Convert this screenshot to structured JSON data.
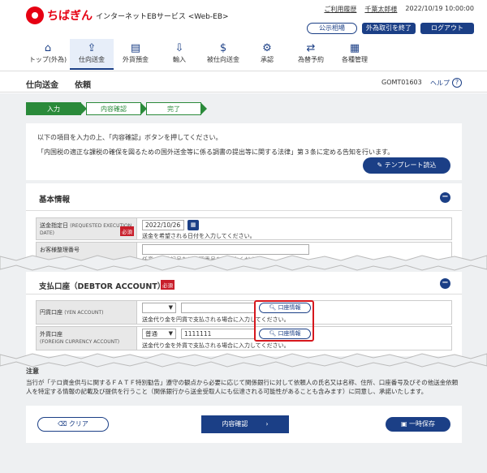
{
  "header": {
    "brand": "ちばぎん",
    "service": "インターネットEBサービス <Web-EB>",
    "links": {
      "usage_history": "ご利用履歴",
      "user": "千葉太郎様",
      "datetime": "2022/10/19 10:00:00"
    },
    "buttons": {
      "market": "公示相場",
      "fx_end": "外為取引を終了",
      "logout": "ログアウト"
    }
  },
  "nav": [
    {
      "label": "トップ(外為)",
      "icon": "home-icon"
    },
    {
      "label": "仕向送金",
      "icon": "send-icon"
    },
    {
      "label": "外貨預金",
      "icon": "deposit-icon"
    },
    {
      "label": "輸入",
      "icon": "import-icon"
    },
    {
      "label": "被仕向送金",
      "icon": "receive-icon"
    },
    {
      "label": "承認",
      "icon": "approve-icon"
    },
    {
      "label": "為替予約",
      "icon": "exchange-icon"
    },
    {
      "label": "各種管理",
      "icon": "manage-icon"
    }
  ],
  "title": {
    "main": "仕向送金",
    "sub": "依頼",
    "code": "GOMT01603",
    "help": "ヘルプ"
  },
  "steps": [
    "入力",
    "内容確認",
    "完了"
  ],
  "intro": {
    "line1": "以下の項目を入力の上、「内容確認」ボタンを押してください。",
    "line2": "「内国税の適正な課税の確保を図るための国外送金等に係る調書の提出等に関する法律」第３条に定める告知を行います。",
    "template_button": "テンプレート読込"
  },
  "basic": {
    "heading": "基本情報",
    "rows": [
      {
        "label": "送金指定日",
        "label_en": "(REQUESTED EXECUTION DATE)",
        "required": "必須",
        "value": "2022/10/26",
        "hint": "送金を希望される日付を入力してください。"
      },
      {
        "label": "お客様整理番号",
        "hint": "任意の英数記号など管理番号をご入力ください。"
      }
    ]
  },
  "debtor": {
    "heading": "支払口座（DEBTOR ACCOUNT）",
    "required": "必須",
    "rows": [
      {
        "label": "円貨口座",
        "label_en": "(YEN ACCOUNT)",
        "select": "",
        "value": "",
        "button": "口座情報",
        "hint": "送金代り金を円貨で支払される場合に入力してください。"
      },
      {
        "label": "外貨口座",
        "label_en": "(FOREIGN CURRENCY ACCOUNT)",
        "select": "普通",
        "value": "1111111",
        "button": "口座情報",
        "hint": "送金代り金を外貨で支払される場合に入力してください。"
      }
    ]
  },
  "notice": {
    "heading": "注意",
    "text": "当行が「テロ資金供与に関するＦＡＴＦ特別勧告」遵守の観点から必要に応じて関係銀行に対して依頼人の氏名又は名称、住所、口座番号及びその他送金依頼人を特定する情報の記載及び提供を行うこと（関係銀行から送金受取人にも伝達される可能性があることも含みます）に同意し、承諾いたします。"
  },
  "actions": {
    "clear": "クリア",
    "confirm": "内容確認",
    "save": "一時保存"
  },
  "colors": {
    "accent": "#1b3f86",
    "brand_red": "#e60012",
    "step_green": "#2a8a3a",
    "highlight": "#d6171d"
  }
}
